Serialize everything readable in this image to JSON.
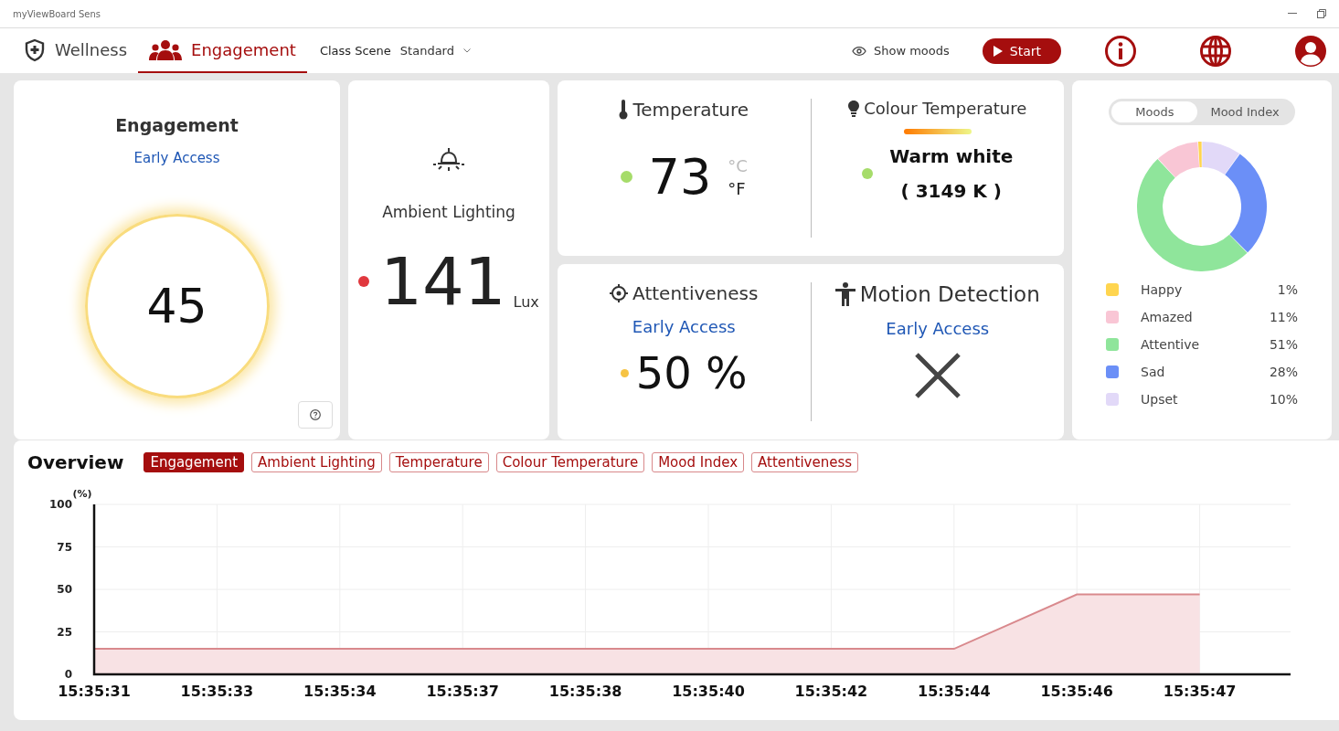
{
  "window": {
    "title": "myViewBoard Sens"
  },
  "nav": {
    "tabs": [
      {
        "label": "Wellness",
        "kind": "shield",
        "selected": false
      },
      {
        "label": "Engagement",
        "kind": "people",
        "selected": true
      }
    ],
    "scene_label": "Class Scene",
    "scene_value": "Standard",
    "show_moods": "Show moods",
    "start": "Start"
  },
  "engagement": {
    "title": "Engagement",
    "badge": "Early Access",
    "value": "45"
  },
  "ambient": {
    "title": "Ambient Lighting",
    "value": "141",
    "unit": "Lux",
    "color": "#e0383e"
  },
  "temperature": {
    "title": "Temperature",
    "value": "73",
    "color": "#a6dc6a",
    "units": [
      {
        "label": "°C",
        "selected": false
      },
      {
        "label": "°F",
        "selected": true
      }
    ]
  },
  "colour_temperature": {
    "title": "Colour Temperature",
    "name": "Warm white",
    "value": "( 3149 K )",
    "color": "#a6dc6a"
  },
  "attentiveness": {
    "title": "Attentiveness",
    "badge": "Early Access",
    "value": "50 %",
    "color": "#f6c343"
  },
  "motion": {
    "title": "Motion Detection",
    "badge": "Early Access"
  },
  "moods": {
    "toggle": [
      {
        "label": "Moods",
        "selected": true
      },
      {
        "label": "Mood Index",
        "selected": false
      }
    ],
    "chart_data": {
      "type": "donut",
      "categories": [
        "Happy",
        "Amazed",
        "Attentive",
        "Sad",
        "Upset"
      ],
      "values": [
        1,
        11,
        51,
        28,
        10
      ],
      "colors": [
        "#ffd54f",
        "#f9c6d5",
        "#8fe59b",
        "#6b8ff7",
        "#e2d9f8"
      ]
    },
    "legend": [
      {
        "value": "1%",
        "color": "#ffd54f"
      },
      {
        "value": "11%",
        "color": "#f9c6d5"
      },
      {
        "value": "51%",
        "color": "#8fe59b"
      },
      {
        "value": "28%",
        "color": "#6b8ff7"
      },
      {
        "value": "10%",
        "color": "#e2d9f8"
      }
    ]
  },
  "overview": {
    "title": "Overview",
    "filters": [
      {
        "label": "Engagement",
        "selected": true
      },
      {
        "label": "Ambient Lighting",
        "selected": false
      },
      {
        "label": "Temperature",
        "selected": false
      },
      {
        "label": "Colour Temperature",
        "selected": false
      },
      {
        "label": "Mood Index",
        "selected": false
      },
      {
        "label": "Attentiveness",
        "selected": false
      }
    ],
    "chart_data": {
      "type": "area",
      "ylabel": "(%)",
      "categories": [
        "15:35:31",
        "15:35:33",
        "15:35:34",
        "15:35:37",
        "15:35:38",
        "15:35:40",
        "15:35:42",
        "15:35:44",
        "15:35:46",
        "15:35:47"
      ],
      "series": [
        {
          "color": "#d9898d",
          "values": [
            15,
            15,
            15,
            15,
            15,
            15,
            15,
            15,
            47,
            47
          ]
        }
      ],
      "ylim": [
        0,
        100
      ],
      "yticks": [
        0,
        25,
        50,
        75,
        100
      ],
      "grid": true
    }
  }
}
